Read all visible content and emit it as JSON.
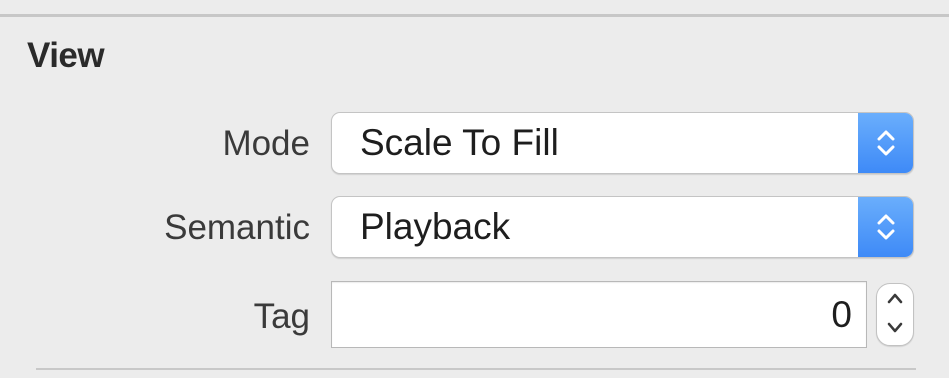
{
  "section": {
    "title": "View"
  },
  "mode": {
    "label": "Mode",
    "value": "Scale To Fill"
  },
  "semantic": {
    "label": "Semantic",
    "value": "Playback"
  },
  "tag": {
    "label": "Tag",
    "value": "0"
  },
  "colors": {
    "accent": "#3e8af7",
    "panel_background": "#ececec"
  },
  "icons": {
    "popup_arrows": "up-down-chevron-icon",
    "stepper_up": "chevron-up-icon",
    "stepper_down": "chevron-down-icon"
  }
}
